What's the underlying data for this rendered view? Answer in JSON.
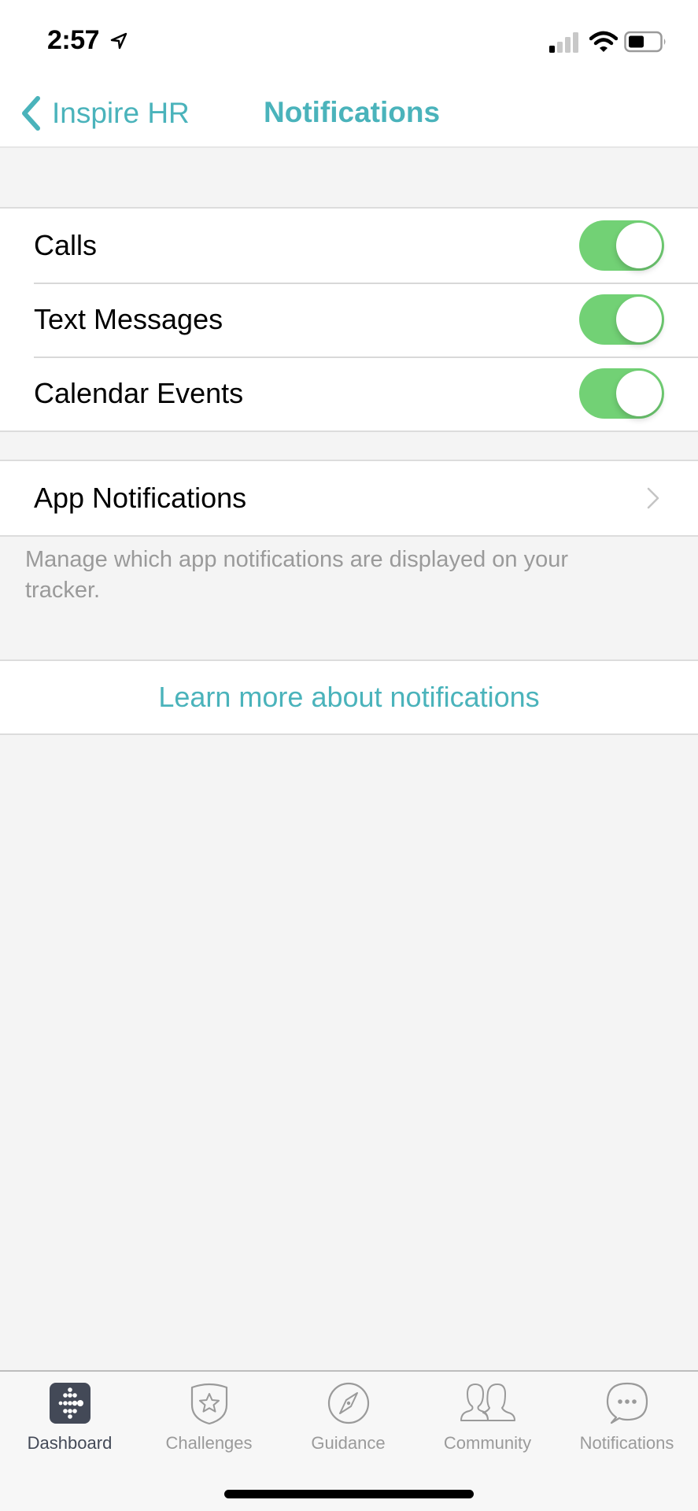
{
  "status_bar": {
    "time": "2:57",
    "icons": [
      "location-arrow-icon",
      "cellular-signal-icon",
      "wifi-icon",
      "battery-icon"
    ],
    "signal_bars_active": 1,
    "signal_bars_total": 4,
    "battery_level_percent": 45
  },
  "nav": {
    "back_label": "Inspire HR",
    "title": "Notifications",
    "accent_color": "#4ab3bb"
  },
  "toggles": [
    {
      "label": "Calls",
      "on": true
    },
    {
      "label": "Text Messages",
      "on": true
    },
    {
      "label": "Calendar Events",
      "on": true
    }
  ],
  "toggle_on_color": "#72d175",
  "app_notifications": {
    "label": "App Notifications",
    "description": "Manage which app notifications are displayed on your tracker."
  },
  "learn_more_link": "Learn more about notifications",
  "tab_bar": {
    "active_index": 0,
    "tabs": [
      {
        "label": "Dashboard",
        "icon": "fitbit-dots-icon"
      },
      {
        "label": "Challenges",
        "icon": "star-badge-icon"
      },
      {
        "label": "Guidance",
        "icon": "compass-icon"
      },
      {
        "label": "Community",
        "icon": "people-icon"
      },
      {
        "label": "Notifications",
        "icon": "chat-bubble-icon"
      }
    ]
  }
}
